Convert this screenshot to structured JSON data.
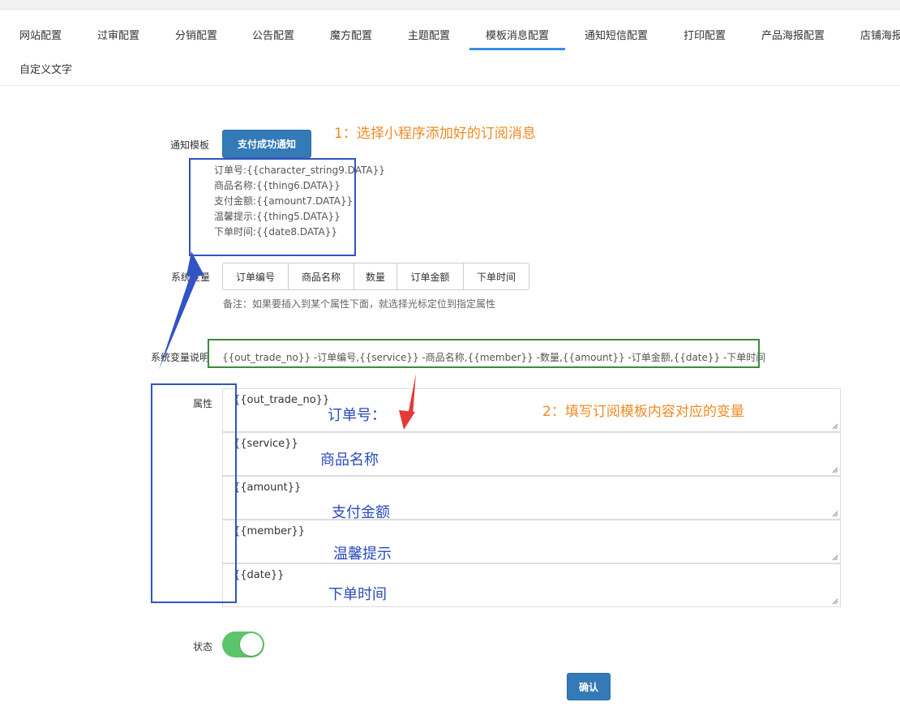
{
  "tabs": [
    {
      "label": "网站配置"
    },
    {
      "label": "过审配置"
    },
    {
      "label": "分销配置"
    },
    {
      "label": "公告配置"
    },
    {
      "label": "魔方配置"
    },
    {
      "label": "主题配置"
    },
    {
      "label": "模板消息配置",
      "active": true
    },
    {
      "label": "通知短信配置"
    },
    {
      "label": "打印配置"
    },
    {
      "label": "产品海报配置"
    },
    {
      "label": "店铺海报"
    },
    {
      "label": "自定义文字"
    }
  ],
  "form": {
    "template_label": "通知模板",
    "template_button": "支付成功通知",
    "template_lines": [
      "订单号:{{character_string9.DATA}}",
      "商品名称:{{thing6.DATA}}",
      "支付金额:{{amount7.DATA}}",
      "温馨提示:{{thing5.DATA}}",
      "下单时间:{{date8.DATA}}"
    ],
    "sysvar_label": "系统变量",
    "sysvars": [
      "订单编号",
      "商品名称",
      "数量",
      "订单金额",
      "下单时间"
    ],
    "note": "备注：如果要插入到某个属性下面，就选择光标定位到指定属性",
    "desc_label": "系统变量说明",
    "desc_text": "{{out_trade_no}} -订单编号,{{service}} -商品名称,{{member}} -数量,{{amount}} -订单金额,{{date}} -下单时间",
    "attr_label": "属性",
    "attributes": [
      "{{out_trade_no}}",
      "{{service}}",
      "{{amount}}",
      "{{member}}",
      "{{date}}"
    ],
    "status_label": "状态",
    "status_on": true,
    "confirm_label": "确认"
  },
  "annotations": {
    "step1": "1：选择小程序添加好的订阅消息",
    "step2": "2：填写订阅模板内容对应的变量",
    "field_names": [
      "订单号：",
      "商品名称",
      "支付金额",
      "温馨提示",
      "下单时间"
    ]
  },
  "colors": {
    "primary": "#337ab7",
    "tab_underline": "#3a8ee6",
    "annotation_orange": "#f08a24",
    "annotation_blue": "#2a4bbd",
    "box_blue": "#3153c4",
    "box_green": "#3c8a3c",
    "arrow_red": "#e53935",
    "toggle_on": "#5cc46a"
  }
}
